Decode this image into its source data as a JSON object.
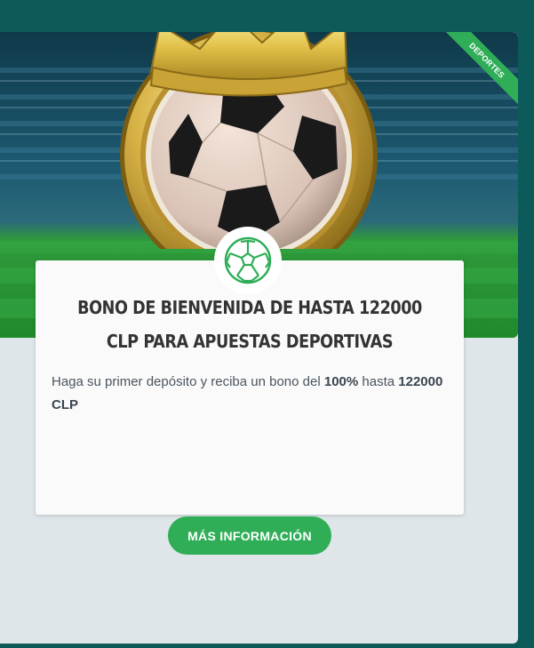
{
  "promo": {
    "ribbon_label": "DEPORTES",
    "title": "BONO DE BIENVENIDA DE HASTA 122000 CLP PARA APUESTAS DEPORTIVAS",
    "description_prefix": "Haga su primer depósito y reciba un bono del ",
    "description_percent": "100%",
    "description_middle": " hasta ",
    "description_amount": "122000 CLP",
    "cta_label": "MÁS INFORMACIÓN"
  },
  "colors": {
    "accent_green": "#2fae57",
    "page_background": "#0c5a5a",
    "card_background": "#dfe6ea"
  },
  "icons": {
    "hero": "crowned-soccer-ball",
    "badge": "soccer-ball-icon"
  }
}
